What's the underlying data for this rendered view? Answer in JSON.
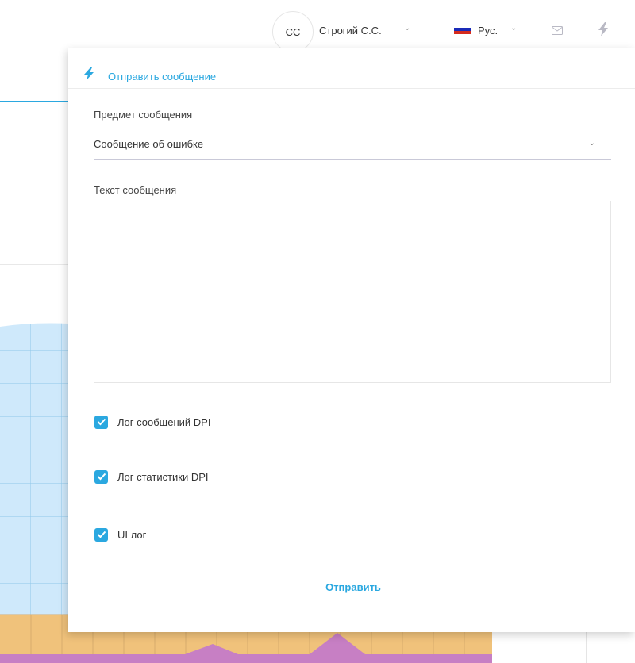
{
  "header": {
    "avatar_initials": "СС",
    "user_name": "Строгий С.С.",
    "language": "Рус.",
    "icons": [
      "chevron-down-icon",
      "flag-ru-icon",
      "mail-icon",
      "bolt-icon"
    ]
  },
  "popup": {
    "title": "Отправить сообщение",
    "subject": {
      "label": "Предмет сообщения",
      "value": "Сообщение об ошибке"
    },
    "message": {
      "label": "Текст сообщения",
      "value": ""
    },
    "checkboxes": [
      {
        "label": "Лог сообщений DPI",
        "checked": true
      },
      {
        "label": "Лог статистики DPI",
        "checked": true
      },
      {
        "label": "UI лог",
        "checked": true
      }
    ],
    "send_label": "Отправить"
  },
  "colors": {
    "accent": "#2ba8e0",
    "chart_area_blue": "#cfe9fb",
    "chart_area_orange": "#f0c27b",
    "chart_area_purple": "#c77fc4"
  }
}
